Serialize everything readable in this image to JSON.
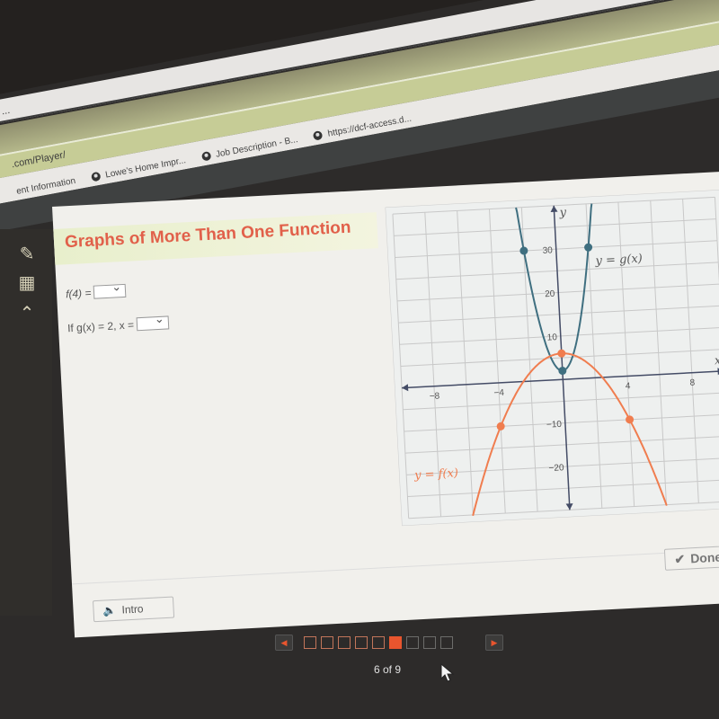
{
  "browser": {
    "tab_fragment": "...",
    "address": ".com/Player/",
    "bookmarks": [
      {
        "label": "ent Information",
        "icon": "none"
      },
      {
        "label": "Lowe's Home Impr...",
        "icon": "globe-icon"
      },
      {
        "label": "Job Description - B...",
        "icon": "globe-icon"
      },
      {
        "label": "https://dcf-access.d...",
        "icon": "globe-icon"
      }
    ]
  },
  "sidebar": {
    "tools": [
      {
        "name": "pencil-icon",
        "glyph": "✎"
      },
      {
        "name": "calculator-icon",
        "glyph": "▦"
      },
      {
        "name": "up-arrow-icon",
        "glyph": "⌃"
      }
    ]
  },
  "lesson": {
    "title": "Graphs of More Than One Function",
    "questions": [
      {
        "prompt": "f(4) =",
        "selected": ""
      },
      {
        "prompt": "If g(x) = 2, x =",
        "selected": ""
      }
    ]
  },
  "chart_data": {
    "type": "line",
    "title": "",
    "xlabel": "x",
    "ylabel": "y",
    "xlim": [
      -10,
      10
    ],
    "ylim": [
      -30,
      40
    ],
    "x_ticks": [
      -8,
      -4,
      4,
      8
    ],
    "y_ticks": [
      -20,
      -10,
      10,
      20,
      30
    ],
    "x_grid_step": 2,
    "y_grid_step": 5,
    "grid": true,
    "series": [
      {
        "name": "y = g(x)",
        "color": "#3f6f80",
        "formula": "7x^2 + 2",
        "points": [
          {
            "x": -2,
            "y": 30
          },
          {
            "x": 0,
            "y": 2
          },
          {
            "x": 2,
            "y": 30
          }
        ]
      },
      {
        "name": "y = f(x)",
        "color": "#f07d4f",
        "formula": "6 - x^2",
        "points": [
          {
            "x": -4,
            "y": -10
          },
          {
            "x": 0,
            "y": 6
          },
          {
            "x": 4,
            "y": -10
          }
        ]
      }
    ]
  },
  "footer": {
    "intro_label": "Intro",
    "done_label": "Done"
  },
  "navigation": {
    "prev_label": "◀",
    "next_label": "▶",
    "current": 6,
    "total": 9,
    "page_text": "6 of 9"
  }
}
